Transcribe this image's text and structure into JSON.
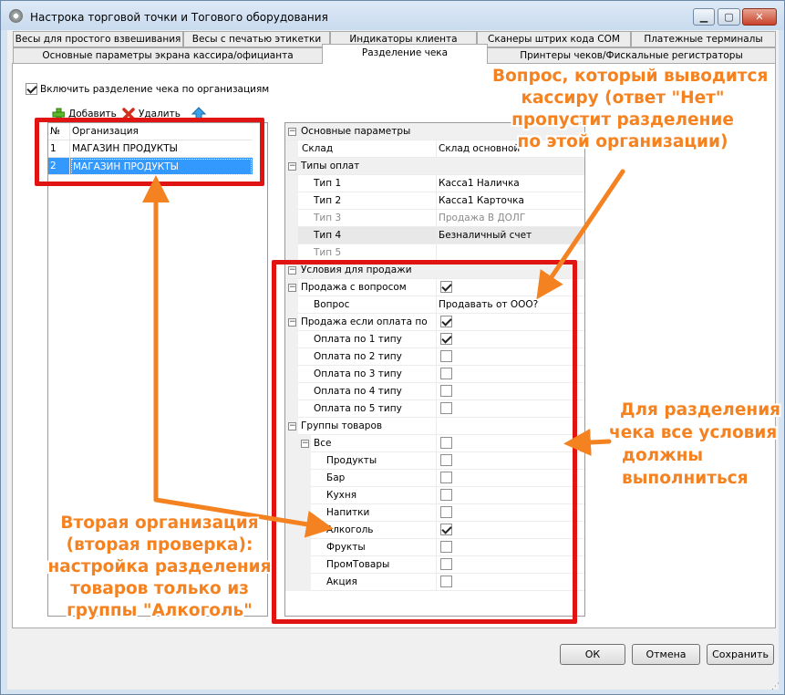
{
  "window": {
    "title": "Настрока торговой точки и Тогового оборудования"
  },
  "tabs": {
    "row1": [
      "Весы для простого взвешивания",
      "Весы с печатью этикетки",
      "Индикаторы клиента",
      "Сканеры штрих кода COM",
      "Платежные терминалы"
    ],
    "row2": [
      "Основные параметры экрана кассира/официанта",
      "Разделение чека",
      "Принтеры чеков/Фискальные регистраторы"
    ],
    "active": "Разделение чека"
  },
  "split_checkbox": {
    "label": "Включить разделение чека по организациям",
    "checked": true
  },
  "toolbar": {
    "add_label": "Добавить",
    "delete_label": "Удалить"
  },
  "org_grid": {
    "headers": [
      "№",
      "Организация"
    ],
    "rows": [
      {
        "num": "1",
        "name": "МАГАЗИН ПРОДУКТЫ"
      },
      {
        "num": "2",
        "name": "МАГАЗИН ПРОДУКТЫ"
      }
    ],
    "selected_row": 2
  },
  "props": {
    "main_params": "Основные параметры",
    "warehouse_label": "Склад",
    "warehouse_value": "Склад основной",
    "payment_types": "Типы оплат",
    "types": [
      {
        "label": "Тип 1",
        "value": "Касса1 Наличка"
      },
      {
        "label": "Тип 2",
        "value": "Касса1 Карточка"
      },
      {
        "label": "Тип 3",
        "value": "Продажа В ДОЛГ"
      },
      {
        "label": "Тип 4",
        "value": "Безналичный счет"
      },
      {
        "label": "Тип 5",
        "value": ""
      }
    ],
    "sale_conditions": "Условия для продажи",
    "sale_with_question": "Продажа с вопросом",
    "sale_with_question_checked": true,
    "question_label": "Вопрос",
    "question_value": "Продавать от ООО?",
    "sale_if_payment": "Продажа если оплата по",
    "sale_if_payment_checked": true,
    "payment_by": [
      {
        "label": "Оплата по 1 типу",
        "checked": true
      },
      {
        "label": "Оплата по 2 типу",
        "checked": false
      },
      {
        "label": "Оплата по 3 типу",
        "checked": false
      },
      {
        "label": "Оплата по 4 типу",
        "checked": false
      },
      {
        "label": "Оплата по 5 типу",
        "checked": false
      }
    ],
    "product_groups": "Группы товаров",
    "all_label": "Все",
    "all_checked": false,
    "groups": [
      {
        "label": "Продукты",
        "checked": false
      },
      {
        "label": "Бар",
        "checked": false
      },
      {
        "label": "Кухня",
        "checked": false
      },
      {
        "label": "Напитки",
        "checked": false
      },
      {
        "label": "Алкоголь",
        "checked": true
      },
      {
        "label": "Фрукты",
        "checked": false
      },
      {
        "label": "ПромТовары",
        "checked": false
      },
      {
        "label": "Акция",
        "checked": false
      }
    ]
  },
  "buttons": {
    "ok": "ОК",
    "cancel": "Отмена",
    "save": "Сохранить"
  },
  "annotations": {
    "question": [
      "Вопрос, который выводится",
      "кассиру (ответ \"Нет\"",
      "пропустит разделение",
      "по этой организации)"
    ],
    "conditions": [
      "Для разделения",
      "чека все условия",
      "должны",
      "выполниться"
    ],
    "second_org": [
      "Вторая организация",
      "(вторая проверка):",
      "настройка разделения",
      "товаров только  из",
      "группы \"Алкоголь\""
    ]
  },
  "colors": {
    "annotation": "#f58220",
    "highlight_box": "#e11414",
    "selection": "#3399ff"
  }
}
